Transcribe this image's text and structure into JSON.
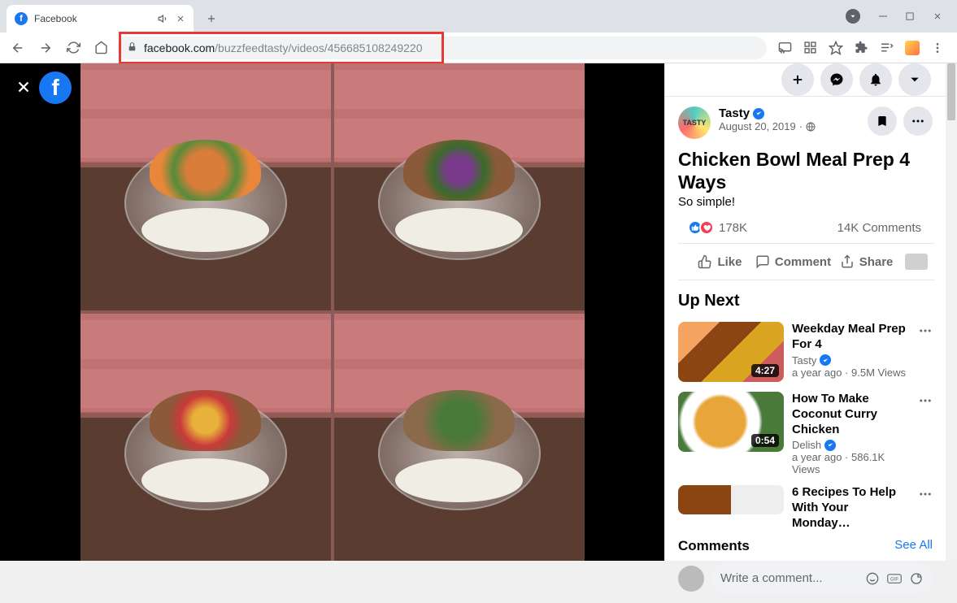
{
  "browser": {
    "tab_title": "Facebook",
    "url_domain": "facebook.com",
    "url_path": "/buzzfeedtasty/videos/456685108249220"
  },
  "header_actions": {
    "create": "+",
    "messenger": "messenger",
    "notifications": "bell",
    "account": "arrow"
  },
  "post": {
    "page_name": "Tasty",
    "page_avatar_text": "TASTY",
    "date": "August 20, 2019",
    "visibility": "public",
    "title": "Chicken Bowl Meal Prep 4 Ways",
    "subtitle": "So simple!",
    "reactions_count": "178K",
    "comments_count": "14K Comments"
  },
  "actions": {
    "like": "Like",
    "comment": "Comment",
    "share": "Share"
  },
  "upnext": {
    "heading": "Up Next",
    "items": [
      {
        "title": "Weekday Meal Prep For 4",
        "page": "Tasty",
        "when": "a year ago",
        "views": "9.5M Views",
        "duration": "4:27"
      },
      {
        "title": "How To Make Coconut Curry Chicken",
        "page": "Delish",
        "when": "a year ago",
        "views": "586.1K Views",
        "duration": "0:54"
      },
      {
        "title": "6 Recipes To Help With Your Monday…",
        "page": "",
        "when": "",
        "views": "",
        "duration": ""
      }
    ]
  },
  "comments": {
    "heading": "Comments",
    "see_all": "See All",
    "placeholder": "Write a comment..."
  }
}
